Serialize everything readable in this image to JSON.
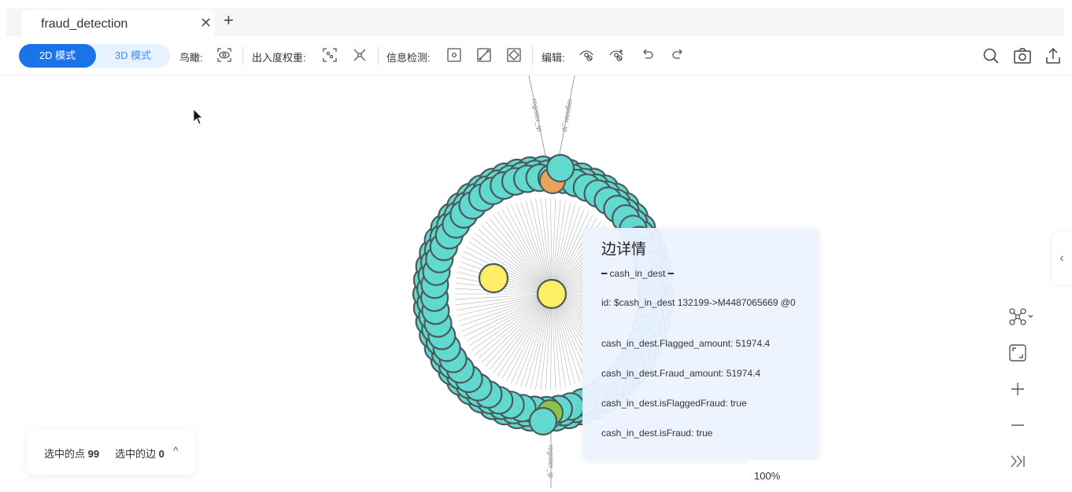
{
  "tab": {
    "title": "fraud_detection"
  },
  "toolbar": {
    "mode_2d": "2D 模式",
    "mode_3d": "3D 模式",
    "birdseye_label": "鸟瞰:",
    "degree_label": "出入度权重:",
    "info_label": "信息检测:",
    "edit_label": "编辑:"
  },
  "graph": {
    "top_edge_labels": [
      "register_ip",
      "register_ip"
    ],
    "bottom_edge_label": "register_ip",
    "colors": {
      "outer_node": "#62d9cf",
      "center_node": "#ffee66",
      "orange_node": "#e8a35a",
      "green_node": "#8bc34a"
    }
  },
  "detail": {
    "title": "边详情",
    "edge_type": "━ cash_in_dest ━",
    "id": "id: $cash_in_dest 132199->M4487065669 @0",
    "rows": [
      "cash_in_dest.Flagged_amount: 51974.4",
      "cash_in_dest.Fraud_amount: 51974.4",
      "cash_in_dest.isFlaggedFraud: true",
      "cash_in_dest.isFraud: true"
    ]
  },
  "selection": {
    "nodes_label": "选中的点",
    "nodes_count": "99",
    "edges_label": "选中的边",
    "edges_count": "0"
  },
  "zoom": {
    "level": "100%"
  }
}
